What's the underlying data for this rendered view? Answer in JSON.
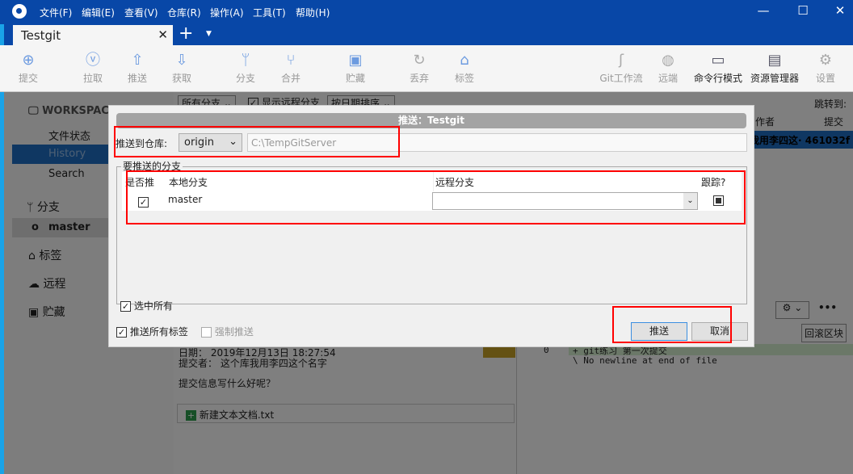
{
  "app": {
    "menus": [
      "文件(F)",
      "编辑(E)",
      "查看(V)",
      "仓库(R)",
      "操作(A)",
      "工具(T)",
      "帮助(H)"
    ],
    "tab": "Testgit",
    "accent": "#0847a7"
  },
  "toolbar": [
    {
      "label": "提交",
      "icon": "plus-circle-icon"
    },
    {
      "label": "拉取",
      "icon": "arrow-down-circle-icon"
    },
    {
      "label": "推送",
      "icon": "arrow-up-circle-icon"
    },
    {
      "label": "获取",
      "icon": "fetch-icon"
    },
    {
      "label": "分支",
      "icon": "branch-icon"
    },
    {
      "label": "合并",
      "icon": "merge-icon"
    },
    {
      "label": "贮藏",
      "icon": "stash-icon"
    },
    {
      "label": "丢弃",
      "icon": "discard-icon"
    },
    {
      "label": "标签",
      "icon": "tag-icon"
    },
    {
      "label": "Git工作流",
      "icon": "git-flow-icon"
    },
    {
      "label": "远端",
      "icon": "globe-icon"
    },
    {
      "label": "命令行模式",
      "icon": "terminal-icon"
    },
    {
      "label": "资源管理器",
      "icon": "folder-icon"
    },
    {
      "label": "设置",
      "icon": "gear-icon"
    }
  ],
  "sidebar": {
    "workspace": "WORKSPACE",
    "items": [
      "文件状态",
      "History",
      "Search"
    ],
    "branches": "分支",
    "branch": "master",
    "tags": "标签",
    "remotes": "远程",
    "stashes": "贮藏"
  },
  "history": {
    "filter": "所有分支",
    "show_remote": "显示远程分支",
    "sort": "按日期排序",
    "jump": "跳转到:",
    "col_author": "作者",
    "col_commit": "提交",
    "row_author": "我用李四这·",
    "row_hash": "461032f"
  },
  "details": {
    "date": "日期： 2019年12月13日 18:27:54",
    "committer": "提交者： 这个库我用李四这个名字",
    "message": "提交信息写什么好呢？",
    "file": "新建文本文档.txt",
    "revert": "回滚区块",
    "diff": [
      "+ git练习 第一次提交",
      "\\  No newline at end of file"
    ],
    "lineno": "0"
  },
  "dialog": {
    "title": "推送：Testgit",
    "repo_label": "推送到仓库:",
    "remote": "origin",
    "remote_url": "C:\\TempGitServer",
    "group": "要推送的分支",
    "col_push": "是否推",
    "col_local": "本地分支",
    "col_remote": "远程分支",
    "col_track": "跟踪?",
    "rows": [
      {
        "push": true,
        "local": "master",
        "remote": "",
        "track": true
      }
    ],
    "select_all": "选中所有",
    "push_tags": "推送所有标签",
    "force": "强制推送",
    "ok": "推送",
    "cancel": "取消"
  }
}
